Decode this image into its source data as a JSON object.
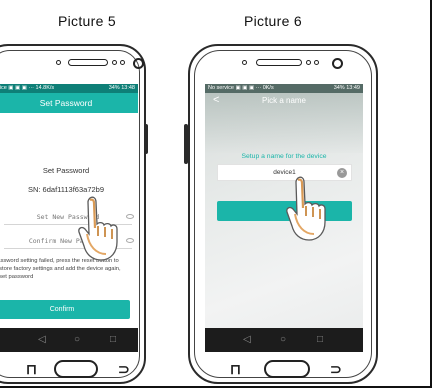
{
  "captions": {
    "left": "Picture 5",
    "right": "Picture 6"
  },
  "phone5": {
    "status": {
      "left": "vice ▣ ▣ ▣ ··· 14.8K/s",
      "right": "34% 13:48"
    },
    "title": "Set Password",
    "heading": "Set Password",
    "serial": "SN: 6daf1113f63a72b9",
    "new_password_placeholder": "Set New Password",
    "confirm_password_placeholder": "Confirm New Password",
    "note": "password setting failed, press the reset button to restore factory settings and add the device again, reset password",
    "confirm_label": "Confirm",
    "nav": {
      "back": "◁",
      "home": "○",
      "recent": "□"
    }
  },
  "phone6": {
    "status": {
      "left": "No service ▣ ▣ ▣ ··· 0K/s",
      "right": "34% 13:49"
    },
    "back_glyph": "<",
    "title": "Pick a name",
    "setup_label": "Setup a name for the device",
    "device_name": "device1",
    "clear_glyph": "×",
    "nav": {
      "back": "◁",
      "home": "○",
      "recent": "□"
    }
  },
  "colors": {
    "accent": "#1bb5a9",
    "status_bar": "#0e7f77",
    "nav_bar": "#1c1c1c"
  },
  "icons": [
    "eye-icon",
    "clear-icon",
    "back-arrow-icon",
    "hand-pointer-icon"
  ]
}
